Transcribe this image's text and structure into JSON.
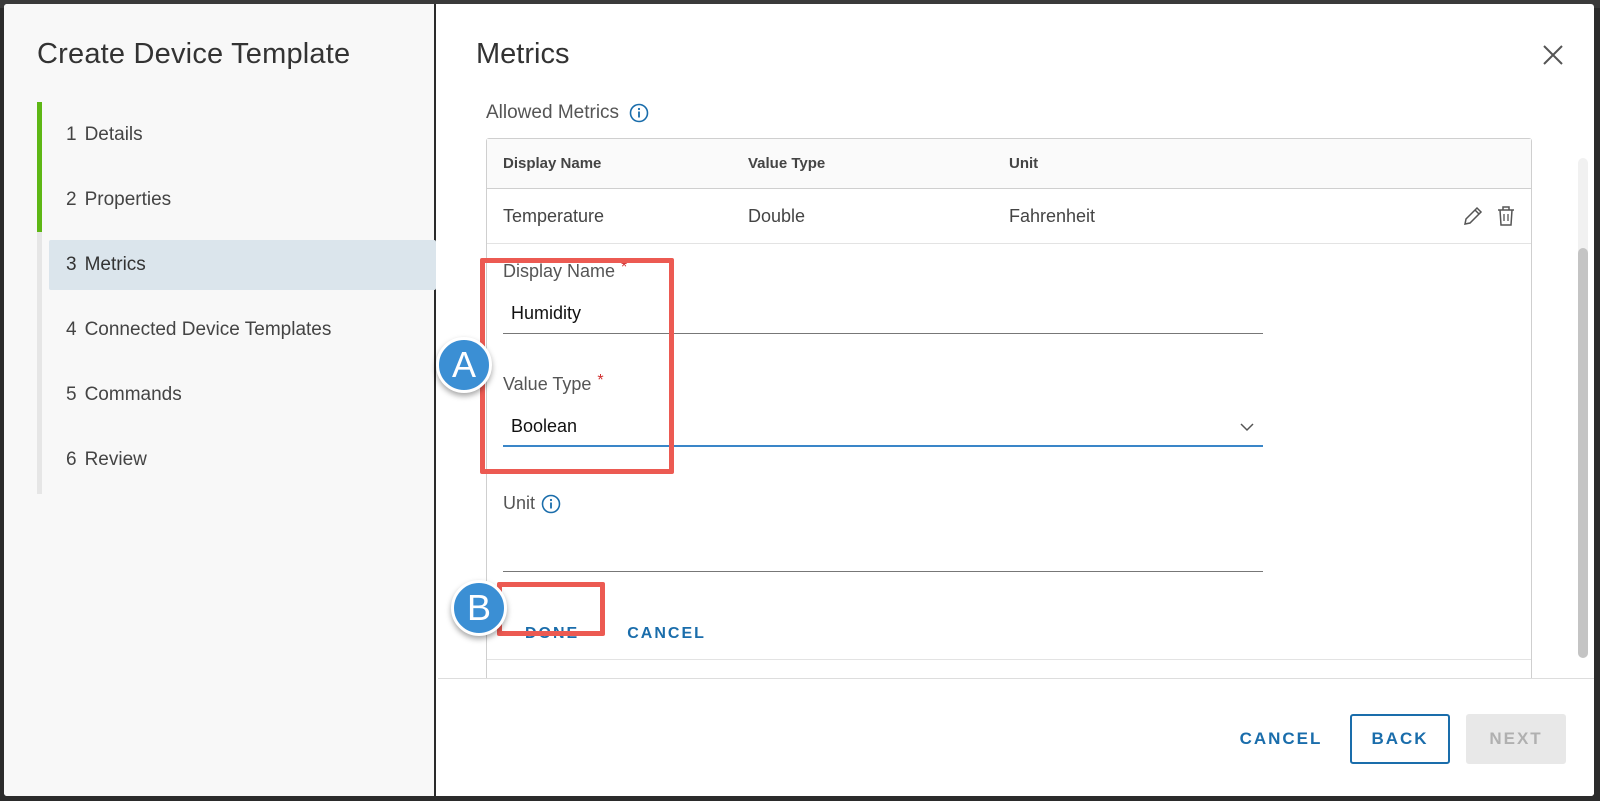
{
  "wizard": {
    "title": "Create Device Template",
    "steps": [
      {
        "num": "1",
        "label": "Details"
      },
      {
        "num": "2",
        "label": "Properties"
      },
      {
        "num": "3",
        "label": "Metrics"
      },
      {
        "num": "4",
        "label": "Connected Device Templates"
      },
      {
        "num": "5",
        "label": "Commands"
      },
      {
        "num": "6",
        "label": "Review"
      }
    ],
    "active_step": "3"
  },
  "content": {
    "title": "Metrics",
    "section_label": "Allowed Metrics"
  },
  "grid": {
    "columns": [
      "Display Name",
      "Value Type",
      "Unit"
    ],
    "rows": [
      {
        "display_name": "Temperature",
        "value_type": "Double",
        "unit": "Fahrenheit"
      }
    ]
  },
  "form": {
    "display_name_label": "Display Name",
    "display_name_value": "Humidity",
    "value_type_label": "Value Type",
    "value_type_value": "Boolean",
    "unit_label": "Unit",
    "unit_value": "",
    "required_mark": "*",
    "done_label": "DONE",
    "cancel_label": "CANCEL"
  },
  "callouts": {
    "a": "A",
    "b": "B"
  },
  "footer": {
    "cancel_label": "CANCEL",
    "back_label": "BACK",
    "next_label": "NEXT"
  },
  "colors": {
    "accent": "#1a6dab",
    "progress": "#5eb715",
    "highlight": "#ec5a52",
    "badge": "#3b8fd4"
  },
  "icons": {
    "close": "close-icon",
    "info": "info-icon",
    "edit": "pencil-icon",
    "delete": "trash-icon",
    "dropdown": "chevron-down-icon"
  }
}
